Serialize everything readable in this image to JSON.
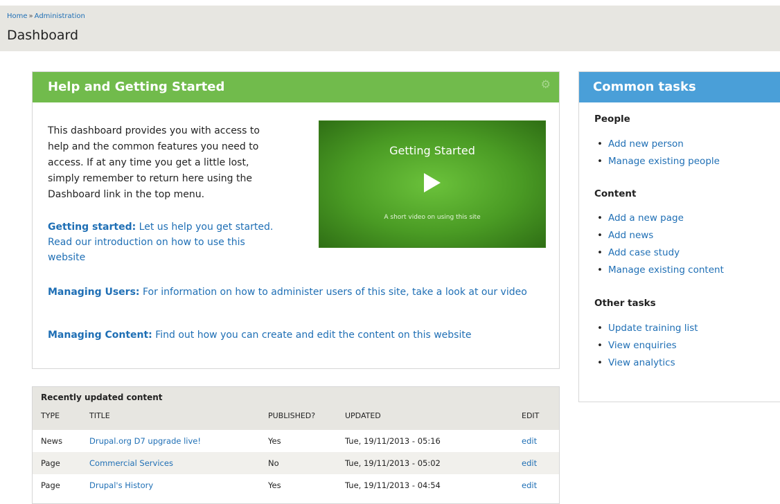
{
  "breadcrumb": {
    "home": "Home",
    "sep": "»",
    "admin": "Administration"
  },
  "page_title": "Dashboard",
  "help": {
    "title": "Help and Getting Started",
    "gear_icon": "gear-icon",
    "intro": "This dashboard provides you with access to help and the common features you need to access. If at any time you get a little lost, simply remember to return here using the Dashboard link in the top menu.",
    "getting_started_label": "Getting started:",
    "getting_started_text": "Let us help you get started. Read our introduction on how to use this website",
    "managing_users_label": "Managing Users:",
    "managing_users_text": "For information on how to administer users of this site, take a look at our video",
    "managing_content_label": "Managing Content:",
    "managing_content_text": "Find out how you can create and edit the content on this website",
    "video_title": "Getting Started",
    "video_caption": "A short video on using this site",
    "video_play_icon": "play-icon"
  },
  "recent": {
    "title": "Recently updated content",
    "columns": [
      "TYPE",
      "TITLE",
      "PUBLISHED?",
      "UPDATED",
      "EDIT"
    ],
    "rows": [
      {
        "type": "News",
        "title": "Drupal.org D7 upgrade live!",
        "published": "Yes",
        "updated": "Tue, 19/11/2013 - 05:16",
        "edit": "edit"
      },
      {
        "type": "Page",
        "title": "Commercial Services",
        "published": "No",
        "updated": "Tue, 19/11/2013 - 05:02",
        "edit": "edit"
      },
      {
        "type": "Page",
        "title": "Drupal's History",
        "published": "Yes",
        "updated": "Tue, 19/11/2013 - 04:54",
        "edit": "edit"
      }
    ]
  },
  "tasks": {
    "title": "Common tasks",
    "groups": [
      {
        "title": "People",
        "items": [
          "Add new person",
          "Manage existing people"
        ]
      },
      {
        "title": "Content",
        "items": [
          "Add a new page",
          "Add news",
          "Add case study",
          "Manage existing content"
        ]
      },
      {
        "title": "Other tasks",
        "items": [
          "Update training list",
          "View enquiries",
          "View analytics"
        ]
      }
    ]
  },
  "colors": {
    "help_header": "#71bb4c",
    "tasks_header": "#4a9fd8",
    "link": "#1f6fb5",
    "header_bg": "#e7e6e1"
  }
}
